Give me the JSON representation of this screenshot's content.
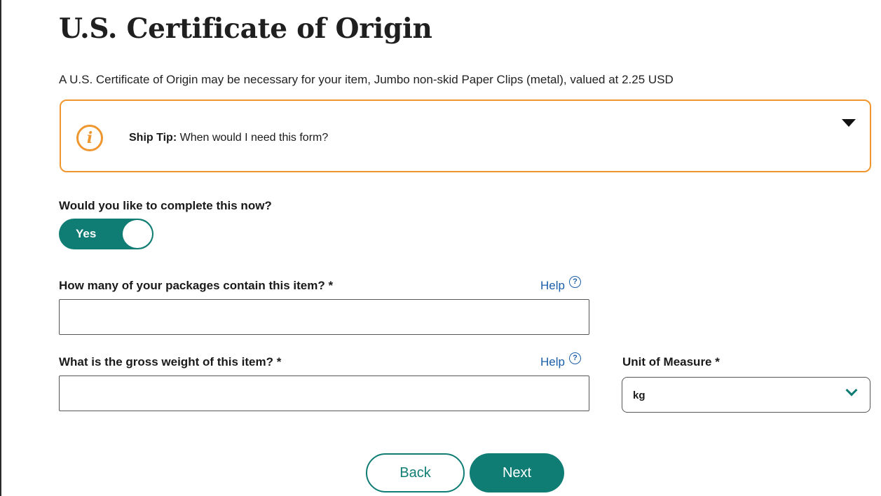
{
  "page": {
    "title": "U.S. Certificate of Origin",
    "intro": "A U.S. Certificate of Origin may be necessary for your item, Jumbo non-skid Paper Clips (metal), valued at 2.25 USD"
  },
  "ship_tip": {
    "prefix": "Ship Tip:",
    "text": "When would I need this form?",
    "icon": "info-icon",
    "expand_icon": "caret-down-icon"
  },
  "complete_now": {
    "question": "Would you like to complete this now?",
    "toggle_label": "Yes",
    "state": "on"
  },
  "packages_field": {
    "label": "How many of your packages contain this item? *",
    "help": "Help",
    "value": ""
  },
  "weight_field": {
    "label": "What is the gross weight of this item? *",
    "help": "Help",
    "value": ""
  },
  "unit_field": {
    "label": "Unit of Measure *",
    "selected": "kg"
  },
  "buttons": {
    "back": "Back",
    "next": "Next"
  },
  "colors": {
    "accent": "#0f7d74",
    "tip_border": "#f0962e",
    "link": "#1a5ea8"
  }
}
